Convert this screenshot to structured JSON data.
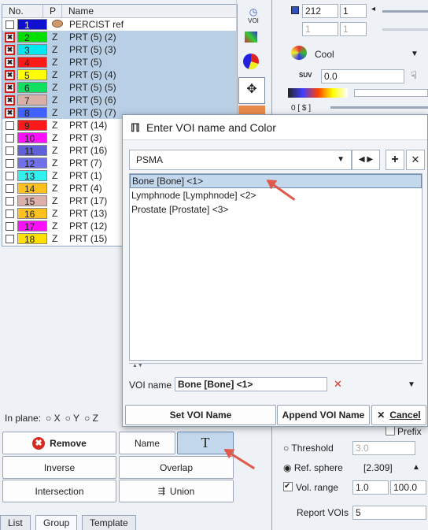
{
  "table": {
    "headers": {
      "no": "No.",
      "p": "P",
      "name": "Name"
    },
    "ref_row": {
      "no": "1",
      "p_icon": "percist-ref-icon",
      "name": "PERCIST ref"
    },
    "rows": [
      {
        "no": "2",
        "p": "Z",
        "name": "PRT (5) (2)",
        "color": "#00e000",
        "checked": "✖"
      },
      {
        "no": "3",
        "p": "Z",
        "name": "PRT (5) (3)",
        "color": "#00e8f0",
        "checked": "✖"
      },
      {
        "no": "4",
        "p": "Z",
        "name": "PRT (5)",
        "color": "#ff1a1a",
        "checked": "✖"
      },
      {
        "no": "5",
        "p": "Z",
        "name": "PRT (5) (4)",
        "color": "#ffff00",
        "checked": "✖"
      },
      {
        "no": "6",
        "p": "Z",
        "name": "PRT (5) (5)",
        "color": "#10e060",
        "checked": "✖"
      },
      {
        "no": "7",
        "p": "Z",
        "name": "PRT (5) (6)",
        "color": "#d9b0a8",
        "checked": "✖"
      },
      {
        "no": "8",
        "p": "Z",
        "name": "PRT (5) (7)",
        "color": "#4060ff",
        "checked": "✖"
      },
      {
        "no": "9",
        "p": "Z",
        "name": "PRT (14)",
        "color": "#ff1a1a",
        "checked": ""
      },
      {
        "no": "10",
        "p": "Z",
        "name": "PRT (3)",
        "color": "#ff10ff",
        "checked": ""
      },
      {
        "no": "11",
        "p": "Z",
        "name": "PRT (16)",
        "color": "#6060d8",
        "checked": ""
      },
      {
        "no": "12",
        "p": "Z",
        "name": "PRT (7)",
        "color": "#7070e8",
        "checked": ""
      },
      {
        "no": "13",
        "p": "Z",
        "name": "PRT (1)",
        "color": "#30f0f0",
        "checked": ""
      },
      {
        "no": "14",
        "p": "Z",
        "name": "PRT (4)",
        "color": "#ffc020",
        "checked": ""
      },
      {
        "no": "15",
        "p": "Z",
        "name": "PRT (17)",
        "color": "#dcb0a8",
        "checked": ""
      },
      {
        "no": "16",
        "p": "Z",
        "name": "PRT (13)",
        "color": "#ffc020",
        "checked": ""
      },
      {
        "no": "17",
        "p": "Z",
        "name": "PRT (12)",
        "color": "#ff10ff",
        "checked": ""
      },
      {
        "no": "18",
        "p": "Z",
        "name": "PRT (15)",
        "color": "#ffe000",
        "checked": ""
      }
    ]
  },
  "inplane": {
    "label": "In plane:",
    "x": "X",
    "y": "Y",
    "z": "Z"
  },
  "buttons": {
    "remove": "Remove",
    "name": "Name",
    "t": "T",
    "inverse": "Inverse",
    "overlap": "Overlap",
    "intersection": "Intersection",
    "union": "Union"
  },
  "tabs": [
    "List",
    "Group",
    "Template"
  ],
  "right": {
    "slice_value": "212",
    "slice_step": "1",
    "dis1": "1",
    "dis2": "1",
    "colormap": "Cool",
    "suv_label": "SUV",
    "suv_value": "0.0",
    "pct_label": "0 [ $ ]",
    "prefix": "Prefix",
    "threshold_label": "Threshold",
    "threshold_value": "3.0",
    "refsphere_label": "Ref. sphere",
    "refsphere_value": "[2.309]",
    "volrange_label": "Vol. range",
    "vol_min": "1.0",
    "vol_max": "100.0",
    "reportvois_label": "Report VOIs",
    "reportvois_value": "5",
    "voi_icon_label": "VOI"
  },
  "dialog": {
    "title": "Enter VOI name and Color",
    "group": "PSMA",
    "items": [
      "Bone [Bone] <1>",
      "Lymphnode [Lymphnode] <2>",
      "Prostate [Prostate] <3>"
    ],
    "voi_name_label": "VOI name",
    "voi_name_value": "Bone [Bone] <1>",
    "set_button": "Set VOI Name",
    "append_button": "Append VOI Name",
    "cancel_button": "Cancel"
  },
  "colors": {
    "accent_red": "#e05a4c",
    "selection": "#c3d7ed"
  }
}
